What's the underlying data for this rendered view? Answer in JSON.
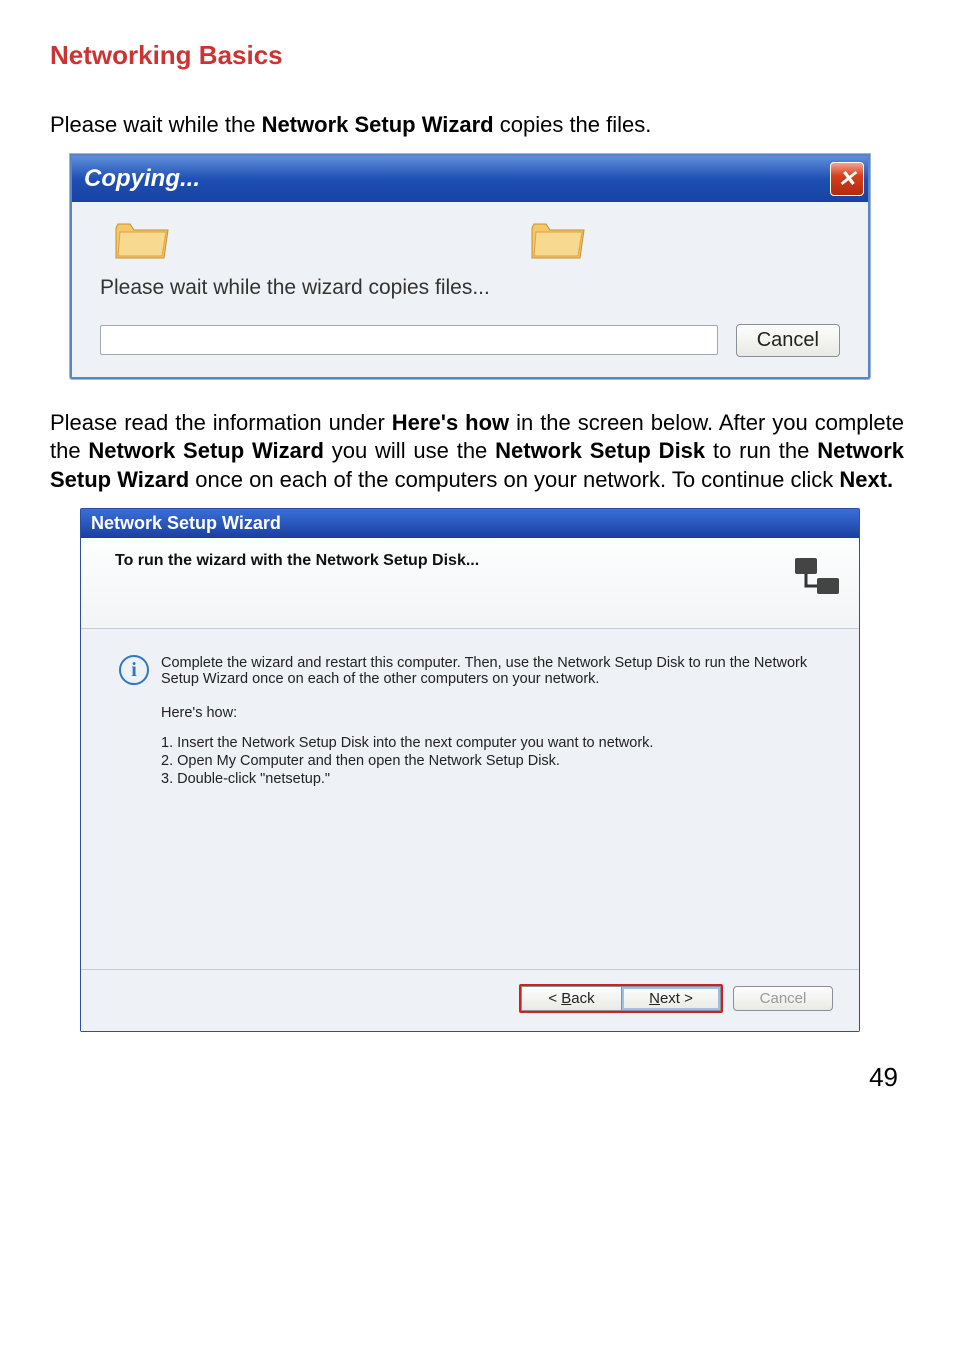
{
  "page": {
    "heading": "Networking Basics",
    "intro_pre": "Please wait while the ",
    "intro_bold": "Network Setup Wizard",
    "intro_post": " copies the files.",
    "middle_1a": "Please read the information under ",
    "middle_1b": "Here's how",
    "middle_1c": " in the screen below.  After you complete the ",
    "middle_1d": "Network Setup Wizard",
    "middle_1e": " you will use the ",
    "middle_1f": "Network Setup Disk",
    "middle_1g": " to run the ",
    "middle_1h": "Network Setup Wizard",
    "middle_1i": " once on each of the computers on your network.  To continue click ",
    "middle_1j": "Next.",
    "page_number": "49"
  },
  "copy_dialog": {
    "title": "Copying...",
    "message": "Please wait while the wizard copies files...",
    "cancel": "Cancel",
    "close_glyph": "✕"
  },
  "wizard": {
    "window_title": "Network Setup Wizard",
    "header_title": "To run the wizard with the Network Setup Disk...",
    "info_text": "Complete the wizard and restart this computer. Then, use the Network Setup Disk to run the Network Setup Wizard once on each of the other computers on your network.",
    "heres_how": "Here's how:",
    "steps": {
      "s1": "1.  Insert the Network Setup Disk into the next computer you want to network.",
      "s2": "2.  Open My Computer and then open the Network Setup Disk.",
      "s3": "3.  Double-click \"netsetup.\""
    },
    "buttons": {
      "back_pre": "< ",
      "back_u": "B",
      "back_post": "ack",
      "next_u": "N",
      "next_post": "ext >",
      "cancel": "Cancel"
    }
  }
}
